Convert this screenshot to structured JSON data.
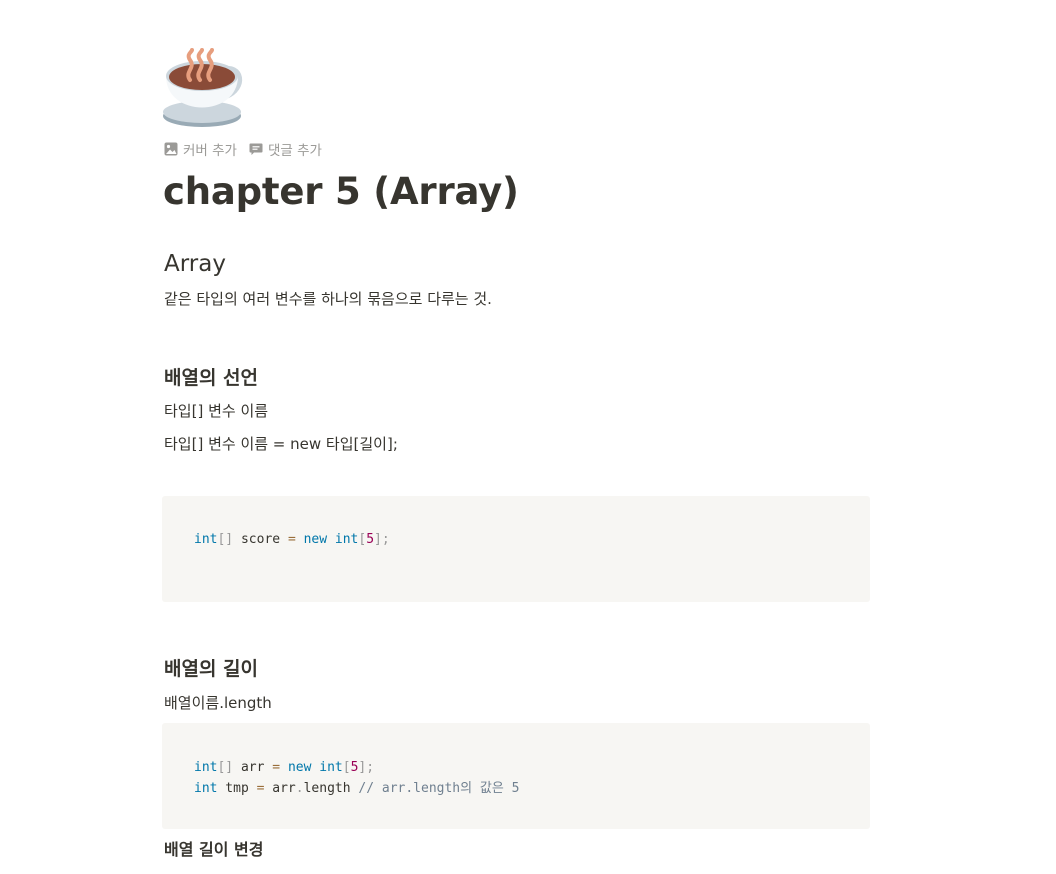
{
  "page": {
    "icon": "hot-beverage-icon",
    "title": "chapter 5 (Array)",
    "controls": {
      "add_cover": "커버 추가",
      "add_comment": "댓글 추가"
    }
  },
  "sections": {
    "array": {
      "heading": "Array",
      "description": "같은 타입의 여러 변수를 하나의 묶음으로 다루는 것."
    },
    "declaration": {
      "heading": "배열의 선언",
      "line1": "타입[] 변수 이름",
      "line2": "타입[] 변수 이름 = new 타입[길이];",
      "code": {
        "l1": {
          "t1": "int",
          "t2": "[]",
          "t3": " score ",
          "t4": "=",
          "t5": " ",
          "t6": "new",
          "t7": " ",
          "t8": "int",
          "t9": "[",
          "t10": "5",
          "t11": "];"
        }
      }
    },
    "length": {
      "heading": "배열의 길이",
      "line1": "배열이름.length",
      "code": {
        "l1": {
          "t1": "int",
          "t2": "[]",
          "t3": " arr ",
          "t4": "=",
          "t5": " ",
          "t6": "new",
          "t7": " ",
          "t8": "int",
          "t9": "[",
          "t10": "5",
          "t11": "];"
        },
        "l2": {
          "t1": "int",
          "t2": " tmp ",
          "t3": "=",
          "t4": " arr",
          "t5": ".",
          "t6": "length ",
          "t7": "// arr.length의 값은 5"
        }
      }
    },
    "change_length": {
      "heading": "배열 길이 변경"
    }
  },
  "colors": {
    "text": "#37352f",
    "muted": "#9b9a97",
    "code_bg": "#f7f6f3",
    "keyword": "#0077aa",
    "number": "#990055",
    "punctuation": "#999999",
    "operator": "#9a6e3a",
    "comment": "#708090"
  }
}
